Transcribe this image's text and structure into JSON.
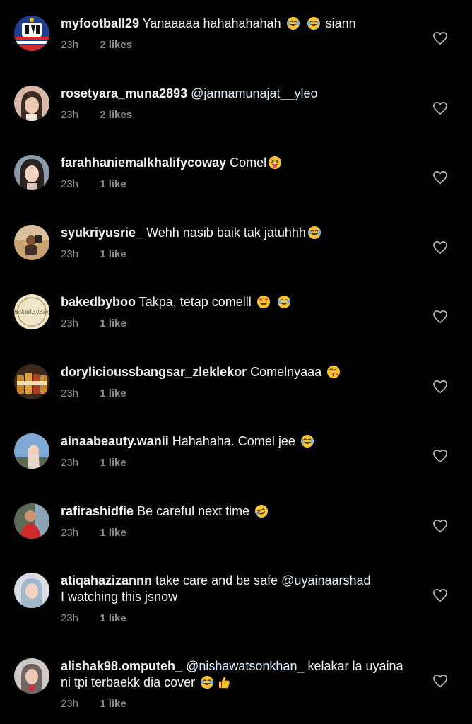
{
  "colors": {
    "background": "#000000",
    "text": "#f5f5f5",
    "meta": "#8e8e8e",
    "mention": "#e0f1ff"
  },
  "comments": [
    {
      "username": "myfootball29",
      "avatar_icon": "football-team-logo-avatar",
      "text_before": "Yanaaaaa hahahahahah",
      "emojis": [
        "tears-of-joy-emoji",
        "tears-of-joy-emoji"
      ],
      "text_after": "siann",
      "time": "23h",
      "likes": "2 likes"
    },
    {
      "username": "rosetyara_muna2893",
      "avatar_icon": "woman-selfie-avatar",
      "mention": "@jannamunajat__yleo",
      "time": "23h",
      "likes": "2 likes"
    },
    {
      "username": "farahhaniemalkhalifycoway",
      "avatar_icon": "woman-portrait-avatar",
      "text_before": "Comel",
      "emojis": [
        "tongue-out-emoji"
      ],
      "time": "23h",
      "likes": "1 like"
    },
    {
      "username": "syukriyusrie_",
      "avatar_icon": "man-outdoor-avatar",
      "text_before": "Wehh nasib baik tak jatuhhh",
      "emojis": [
        "tears-of-joy-emoji"
      ],
      "time": "23h",
      "likes": "1 like"
    },
    {
      "username": "bakedbyboo",
      "avatar_icon": "bakery-logo-avatar",
      "avatar_text": "BakedByBoo",
      "text_before": "Takpa, tetap comelll",
      "emojis": [
        "heart-eyes-emoji",
        "tears-of-joy-emoji"
      ],
      "time": "23h",
      "likes": "1 like"
    },
    {
      "username": "dorylicioussbangsar_zleklekor",
      "avatar_icon": "product-jars-avatar",
      "text_before": "Comelnyaaa",
      "emojis": [
        "blowing-kiss-emoji"
      ],
      "time": "23h",
      "likes": "1 like"
    },
    {
      "username": "ainaabeauty.wanii",
      "avatar_icon": "woman-sky-avatar",
      "text_before": "Hahahaha. Comel jee",
      "emojis": [
        "tears-of-joy-emoji"
      ],
      "time": "23h",
      "likes": "1 like"
    },
    {
      "username": "rafirashidfie",
      "avatar_icon": "man-red-shirt-avatar",
      "text_before": "Be careful next time",
      "emojis": [
        "rolling-laughing-emoji"
      ],
      "time": "23h",
      "likes": "1 like"
    },
    {
      "username": "atiqahazizannn",
      "avatar_icon": "woman-hijab-avatar",
      "text_before": "take care and be safe",
      "mention": "@uyainaarshad",
      "text_after": "I watching this jsnow",
      "time": "23h",
      "likes": "1 like"
    },
    {
      "username": "alishak98.omputeh_",
      "avatar_icon": "woman-hijab-heart-avatar",
      "mention": "@nishawatsonkhan_",
      "text_after": "kelakar la uyaina ni tpi terbaekk dia cover",
      "emojis": [
        "tears-of-joy-emoji",
        "thumbs-up-emoji"
      ],
      "time": "23h",
      "likes": "1 like"
    }
  ]
}
